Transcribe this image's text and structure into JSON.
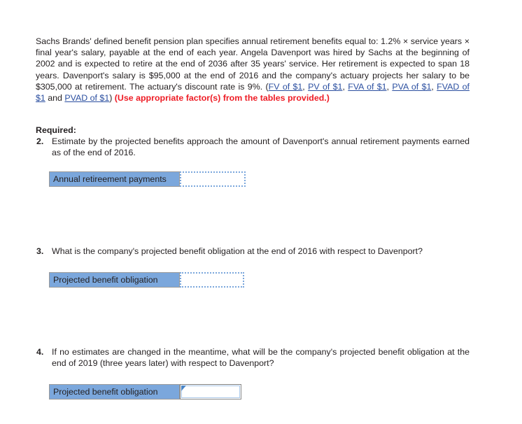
{
  "problem": {
    "intro_part1": "Sachs Brands' defined benefit pension plan specifies annual retirement benefits equal to: 1.2% × service years × final year's salary, payable at the end of each year. Angela Davenport was hired by Sachs at the beginning of 2002 and is expected to retire at the end of 2036 after 35 years' service. Her retirement is expected to span 18 years. Davenport's salary is $95,000 at the end of 2016 and the company's actuary projects her salary to be $305,000 at retirement. The actuary's discount rate is 9%. (",
    "links": [
      {
        "label": "FV of $1",
        "sep": ", "
      },
      {
        "label": "PV of $1",
        "sep": ", "
      },
      {
        "label": "FVA of $1",
        "sep": ", "
      },
      {
        "label": "PVA of $1",
        "sep": ", "
      },
      {
        "label": "FVAD of $1",
        "sep": " and "
      },
      {
        "label": "PVAD of $1",
        "sep": ")"
      }
    ],
    "link_and_word": "and",
    "intro_close": ") ",
    "instruction_bold": "(Use appropriate factor(s) from the tables provided.)",
    "required_label": "Required:"
  },
  "questions": [
    {
      "number": "2.",
      "text": "Estimate by the projected benefits approach the amount of Davenport's annual retirement payments earned as of the end of 2016.",
      "field_label": "Annual retireement payments",
      "field_value": "",
      "field_state": "dotted"
    },
    {
      "number": "3.",
      "text": "What is the company's projected benefit obligation at the end of 2016 with respect to Davenport?",
      "field_label": "Projected benefit obligation",
      "field_value": "",
      "field_state": "dotted"
    },
    {
      "number": "4.",
      "text": "If no estimates are changed in the meantime, what will be the company's projected benefit obligation at the end of 2019 (three years later) with respect to Davenport?",
      "field_label": "Projected benefit obligation",
      "field_value": "",
      "field_state": "focused"
    }
  ],
  "colors": {
    "label_blue": "#7ba7dc",
    "link_blue": "#2b4fa0",
    "alert_red": "#ee1c25",
    "text": "#231f20",
    "background": "#ffffff"
  }
}
